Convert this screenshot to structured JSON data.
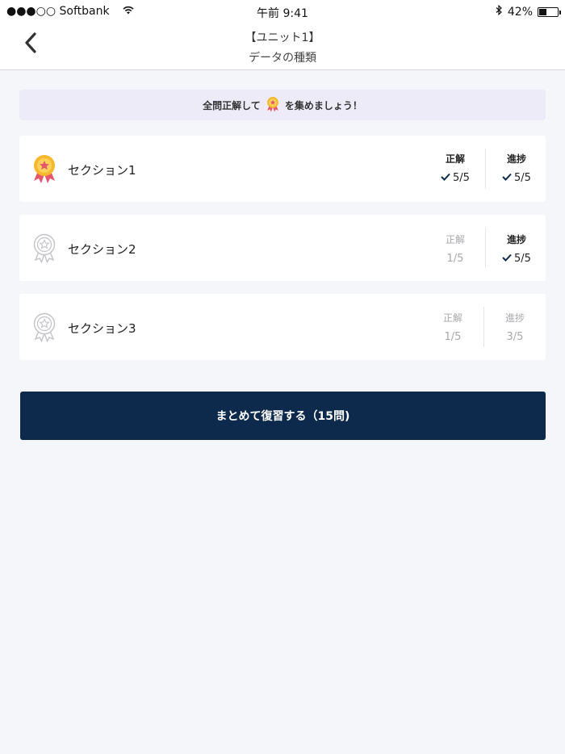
{
  "status_bar": {
    "carrier": "●●●○○ Softbank",
    "time": "午前 9:41",
    "battery_percent": "42%",
    "battery_level": 0.42
  },
  "nav": {
    "title": "【ユニット1】",
    "subtitle": "データの種類"
  },
  "banner": {
    "text_before": "全問正解して",
    "text_after": "を集めましょう！"
  },
  "sections": [
    {
      "name": "セクション1",
      "medal": "gold",
      "correct_label": "正解",
      "correct_value": "5/5",
      "correct_done": true,
      "progress_label": "進捗",
      "progress_value": "5/5",
      "progress_done": true
    },
    {
      "name": "セクション2",
      "medal": "outline",
      "correct_label": "正解",
      "correct_value": "1/5",
      "correct_done": false,
      "progress_label": "進捗",
      "progress_value": "5/5",
      "progress_done": true
    },
    {
      "name": "セクション3",
      "medal": "outline",
      "correct_label": "正解",
      "correct_value": "1/5",
      "correct_done": false,
      "progress_label": "進捗",
      "progress_value": "3/5",
      "progress_done": false
    }
  ],
  "review_button": {
    "label": "まとめて復習する（15問)"
  },
  "colors": {
    "accent_navy": "#0d2a4c",
    "background": "#f5f6fa",
    "banner_bg": "#ecebf7",
    "medal_gold": "#f5b82e",
    "ribbon_red": "#e5556b"
  }
}
